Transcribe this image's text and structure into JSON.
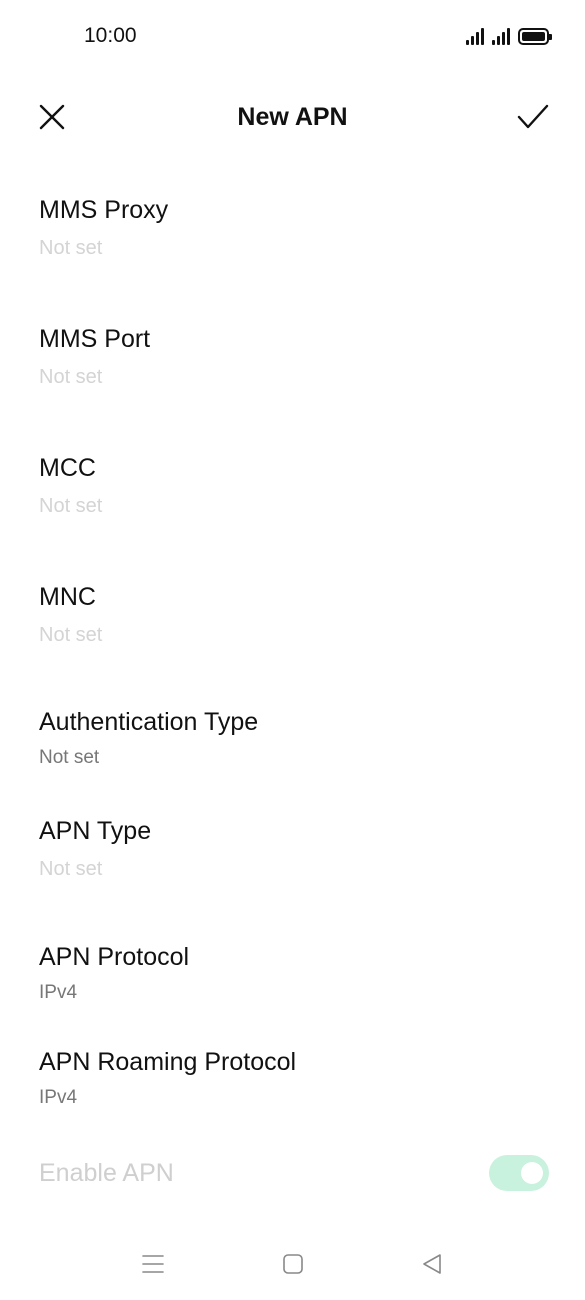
{
  "status_bar": {
    "time": "10:00"
  },
  "toolbar": {
    "title": "New APN",
    "close_icon": "close-icon",
    "confirm_icon": "check-icon"
  },
  "fields": [
    {
      "label": "MMS Proxy",
      "value": "Not set",
      "value_state": "placeholder"
    },
    {
      "label": "MMS Port",
      "value": "Not set",
      "value_state": "placeholder"
    },
    {
      "label": "MCC",
      "value": "Not set",
      "value_state": "placeholder"
    },
    {
      "label": "MNC",
      "value": "Not set",
      "value_state": "placeholder"
    },
    {
      "label": "Authentication Type",
      "value": "Not set",
      "value_state": "set"
    },
    {
      "label": "APN Type",
      "value": "Not set",
      "value_state": "placeholder"
    },
    {
      "label": "APN Protocol",
      "value": "IPv4",
      "value_state": "set"
    },
    {
      "label": "APN Roaming Protocol",
      "value": "IPv4",
      "value_state": "set"
    }
  ],
  "enable_apn": {
    "label": "Enable APN",
    "enabled": true,
    "disabled_look": true
  },
  "nav_bar": {
    "menu_icon": "menu-icon",
    "home_icon": "home-square-icon",
    "back_icon": "back-triangle-icon"
  },
  "colors": {
    "placeholder_text": "#d4d4d4",
    "secondary_text": "#777777",
    "toggle_track": "#c8f1de"
  }
}
